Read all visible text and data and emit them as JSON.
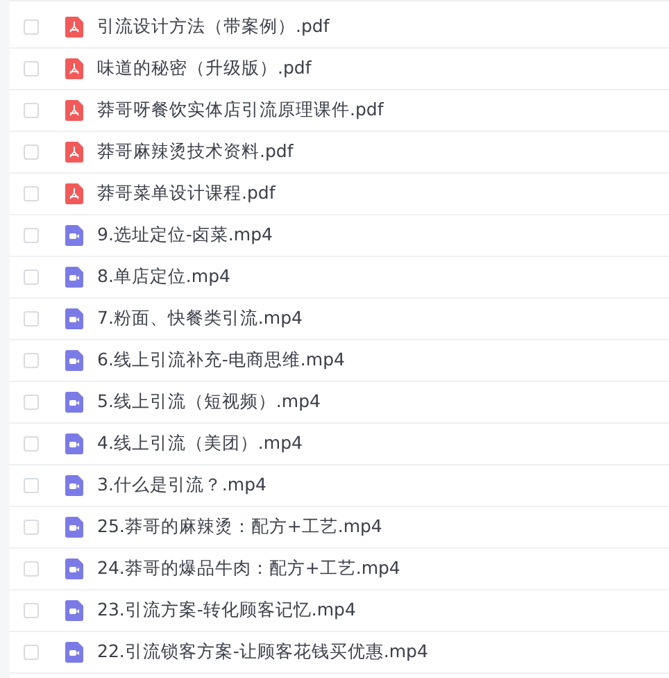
{
  "files": [
    {
      "name": "引流设计方法（带案例）.pdf",
      "kind": "pdf",
      "checked": false
    },
    {
      "name": "味道的秘密（升级版）.pdf",
      "kind": "pdf",
      "checked": false
    },
    {
      "name": "莽哥呀餐饮实体店引流原理课件.pdf",
      "kind": "pdf",
      "checked": false
    },
    {
      "name": "莽哥麻辣烫技术资料.pdf",
      "kind": "pdf",
      "checked": false
    },
    {
      "name": "莽哥菜单设计课程.pdf",
      "kind": "pdf",
      "checked": false
    },
    {
      "name": "9.选址定位-卤菜.mp4",
      "kind": "video",
      "checked": false
    },
    {
      "name": "8.单店定位.mp4",
      "kind": "video",
      "checked": false
    },
    {
      "name": "7.粉面、快餐类引流.mp4",
      "kind": "video",
      "checked": false
    },
    {
      "name": "6.线上引流补充-电商思维.mp4",
      "kind": "video",
      "checked": false
    },
    {
      "name": "5.线上引流（短视频）.mp4",
      "kind": "video",
      "checked": false
    },
    {
      "name": "4.线上引流（美团）.mp4",
      "kind": "video",
      "checked": false
    },
    {
      "name": "3.什么是引流？.mp4",
      "kind": "video",
      "checked": false
    },
    {
      "name": "25.莽哥的麻辣烫：配方+工艺.mp4",
      "kind": "video",
      "checked": false
    },
    {
      "name": "24.莽哥的爆品牛肉：配方+工艺.mp4",
      "kind": "video",
      "checked": false
    },
    {
      "name": "23.引流方案-转化顾客记忆.mp4",
      "kind": "video",
      "checked": false
    },
    {
      "name": "22.引流锁客方案-让顾客花钱买优惠.mp4",
      "kind": "video",
      "checked": false
    }
  ]
}
